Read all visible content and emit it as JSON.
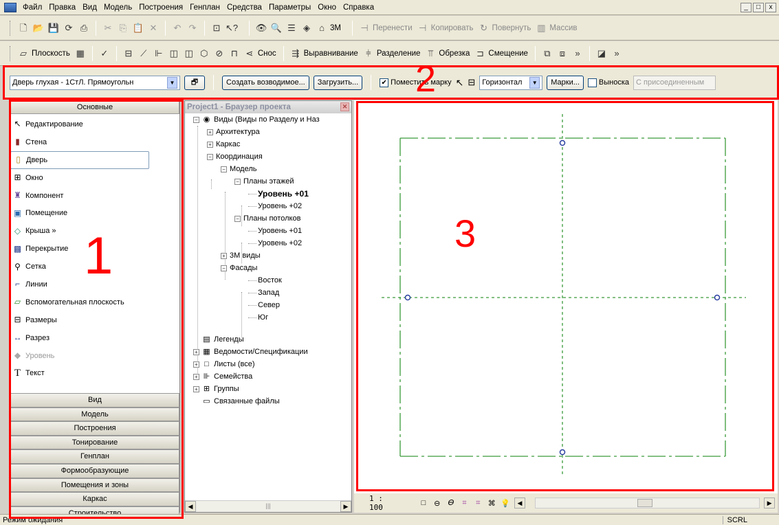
{
  "menubar": {
    "items": [
      "Файл",
      "Правка",
      "Вид",
      "Модель",
      "Построения",
      "Генплан",
      "Средства",
      "Параметры",
      "Окно",
      "Справка"
    ],
    "win_buttons": [
      "_",
      "□",
      "x"
    ]
  },
  "toolbar1": {
    "view3d_label": "3M",
    "move_label": "Перенести",
    "copy_label": "Копировать",
    "rotate_label": "Повернуть",
    "array_label": "Массив"
  },
  "toolbar2": {
    "plane_label": "Плоскость",
    "demolish_label": "Снос",
    "align_label": "Выравнивание",
    "split_label": "Разделение",
    "trim_label": "Обрезка",
    "offset_label": "Смещение"
  },
  "options_bar": {
    "type_selector": "Дверь глухая - 1СтЛ. Прямоугольн",
    "create_host_button": "Создать возводимое...",
    "load_button": "Загрузить...",
    "tag_checkbox_label": "Поместить марку",
    "tag_checkbox_checked": true,
    "orientation": "Горизонтал",
    "tags_button": "Марки...",
    "leader_label": "Выноска",
    "leader_checked": false,
    "attached_label": "С присоединенным"
  },
  "design_bar": {
    "header": "Основные",
    "tools": [
      {
        "label": "Редактирование",
        "icon": "↖"
      },
      {
        "label": "Стена",
        "icon": "▮"
      },
      {
        "label": "Дверь",
        "icon": "▯"
      },
      {
        "label": "Окно",
        "icon": "⊞"
      },
      {
        "label": "Компонент",
        "icon": "♜"
      },
      {
        "label": "Помещение",
        "icon": "▣"
      },
      {
        "label": "Крыша »",
        "icon": "◇"
      },
      {
        "label": "Перекрытие",
        "icon": "▩"
      },
      {
        "label": "Сетка",
        "icon": "⚲"
      },
      {
        "label": "Линии",
        "icon": "⌐"
      },
      {
        "label": "Вспомогательная плоскость",
        "icon": "▱"
      },
      {
        "label": "Размеры",
        "icon": "⊟"
      },
      {
        "label": "Разрез",
        "icon": "↔"
      },
      {
        "label": "Уровень",
        "icon": "◆"
      },
      {
        "label": "Текст",
        "icon": "T"
      }
    ],
    "tabs": [
      "Вид",
      "Модель",
      "Построения",
      "Тонирование",
      "Генплан",
      "Формообразующие",
      "Помещения и зоны",
      "Каркас",
      "Строительство"
    ]
  },
  "browser": {
    "title": "Project1 - Браузер проекта",
    "rows": [
      {
        "label": "Виды (Виды по Разделу и Наз",
        "icon": "◉",
        "pm": "−"
      },
      {
        "label": "Архитектура",
        "pm": "+"
      },
      {
        "label": "Каркас",
        "pm": "+"
      },
      {
        "label": "Координация",
        "pm": "−"
      },
      {
        "label": "Модель",
        "pm": "−"
      },
      {
        "label": "Планы этажей",
        "pm": "−"
      },
      {
        "label": "Уровень +01"
      },
      {
        "label": "Уровень +02"
      },
      {
        "label": "Планы потолков",
        "pm": "−"
      },
      {
        "label": "Уровень +01"
      },
      {
        "label": "Уровень +02"
      },
      {
        "label": "3М виды",
        "pm": "+"
      },
      {
        "label": "Фасады",
        "pm": "−"
      },
      {
        "label": "Восток"
      },
      {
        "label": "Запад"
      },
      {
        "label": "Север"
      },
      {
        "label": "Юг"
      },
      {
        "label": "Легенды",
        "icon": "▤"
      },
      {
        "label": "Ведомости/Спецификации",
        "icon": "▦",
        "pm": "+"
      },
      {
        "label": "Листы (все)",
        "icon": "□",
        "pm": "+"
      },
      {
        "label": "Семейства",
        "icon": "⊪",
        "pm": "+"
      },
      {
        "label": "Группы",
        "icon": "⊞",
        "pm": "+"
      },
      {
        "label": "Связанные файлы",
        "icon": "▭"
      }
    ]
  },
  "view_status": {
    "scale": "1 : 100"
  },
  "statusbar": {
    "text": "Режим ожидания",
    "scrl": "SCRL"
  },
  "annotations": {
    "label_1": "1",
    "label_2": "2",
    "label_3": "3",
    "color": "#ff0000"
  },
  "colors": {
    "grid_line": "#3a9a3a",
    "level_marker": "#2a3fa0"
  }
}
